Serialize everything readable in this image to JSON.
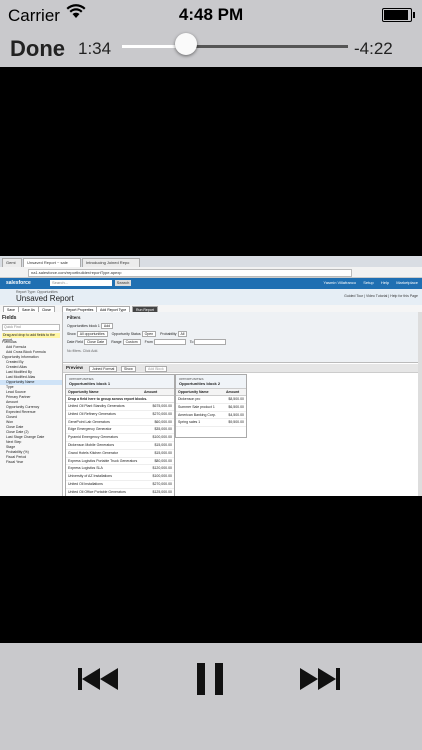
{
  "status_bar": {
    "carrier": "Carrier",
    "time": "4:48 PM"
  },
  "player": {
    "done_label": "Done",
    "elapsed": "1:34",
    "remaining": "-4:22",
    "progress": 0.283
  },
  "video": {
    "browser_tabs": [
      {
        "label": "Gemi"
      },
      {
        "label": "Unsaved Report ~ sale"
      },
      {
        "label": "Introducing Joined Repo"
      }
    ],
    "url": "na1.salesforce.com/reportbuilder/reportType.apexp",
    "header": {
      "logo": "salesforce",
      "search_placeholder": "Search...",
      "search_button": "Search",
      "links": [
        "Yasmin Villafranco",
        "Setup",
        "Help",
        "Marketplace"
      ]
    },
    "title": {
      "crumb": "Report Type: Opportunities",
      "text": "Unsaved Report",
      "help": "Guided Tour | Video Tutorial | Help for this Page"
    },
    "toolbar_buttons": [
      "Save",
      "Save As",
      "Close",
      "Report Properties",
      "Add Report Type",
      "Run Report"
    ],
    "fields_panel": {
      "title": "Fields",
      "quick_find": "Quick Find",
      "tip": "Drag and drop to add fields to the report.",
      "items": [
        {
          "label": "Formulas",
          "folder": true
        },
        {
          "label": "Add Formula"
        },
        {
          "label": "Add Cross Block Formula"
        },
        {
          "label": "Opportunity Information",
          "folder": true
        },
        {
          "label": "Created By"
        },
        {
          "label": "Created Alias"
        },
        {
          "label": "Last Modified By"
        },
        {
          "label": "Last Modified Alias"
        },
        {
          "label": "Opportunity Name",
          "selected": true
        },
        {
          "label": "Type"
        },
        {
          "label": "Lead Source"
        },
        {
          "label": "Primary Partner"
        },
        {
          "label": "Amount"
        },
        {
          "label": "Opportunity Currency"
        },
        {
          "label": "Expected Revenue"
        },
        {
          "label": "Closed"
        },
        {
          "label": "Won"
        },
        {
          "label": "Close Date"
        },
        {
          "label": "Close Date (2)"
        },
        {
          "label": "Last Stage Change Date"
        },
        {
          "label": "Next Step"
        },
        {
          "label": "Stage"
        },
        {
          "label": "Probability (%)"
        },
        {
          "label": "Fiscal Period"
        },
        {
          "label": "Fiscal Year"
        }
      ]
    },
    "filters": {
      "title": "Filters",
      "block_label": "Opportunities block 1",
      "add_label": "Add",
      "row1": [
        "Show",
        "All opportunities",
        "Opportunity Status",
        "Open",
        "Probability",
        "All"
      ],
      "row2": [
        "Date Field",
        "Close Date",
        "Range",
        "Custom",
        "From",
        "To"
      ],
      "hint": "No filters. Click Add."
    },
    "preview": {
      "title": "Preview",
      "format": "Joined Format",
      "show": "Show",
      "add_block": "Add Block"
    },
    "blocks": [
      {
        "kind": "OPPORTUNITIES",
        "name": "Opportunities block 1",
        "columns": [
          "Opportunity Name",
          "Amount"
        ],
        "drop_hint": "Drop a field here to group across report blocks.",
        "rows": [
          [
            "United Oil Plant Standby Generators",
            "$675,000.00"
          ],
          [
            "United Oil Refinery Generators",
            "$270,000.00"
          ],
          [
            "GenePoint Lab Generators",
            "$60,000.00"
          ],
          [
            "Edge Emergency Generator",
            "$35,000.00"
          ],
          [
            "Pyramid Emergency Generators",
            "$100,000.00"
          ],
          [
            "Dickenson Mobile Generators",
            "$15,000.00"
          ],
          [
            "Grand Hotels Kitchen Generator",
            "$15,000.00"
          ],
          [
            "Express Logistics Portable Truck Generators",
            "$80,000.00"
          ],
          [
            "Express Logistics SLA",
            "$120,000.00"
          ],
          [
            "University of AZ Installations",
            "$100,000.00"
          ],
          [
            "United Oil Installations",
            "$270,000.00"
          ],
          [
            "United Oil Office Portable Generators",
            "$125,000.00"
          ],
          [
            "Grand Hotels Guest Portable Generators",
            "$250,000.00"
          ]
        ]
      },
      {
        "kind": "OPPORTUNITIES",
        "name": "Opportunities block 2",
        "columns": [
          "Opportunity Name",
          "Amount"
        ],
        "rows": [
          [
            "Dickenson pro",
            "$8,500.00"
          ],
          [
            "Summer Sale product 1",
            "$6,500.00"
          ],
          [
            "American Banking Corp.",
            "$4,500.00"
          ],
          [
            "Spring sales 1",
            "$9,500.00"
          ]
        ]
      }
    ]
  }
}
